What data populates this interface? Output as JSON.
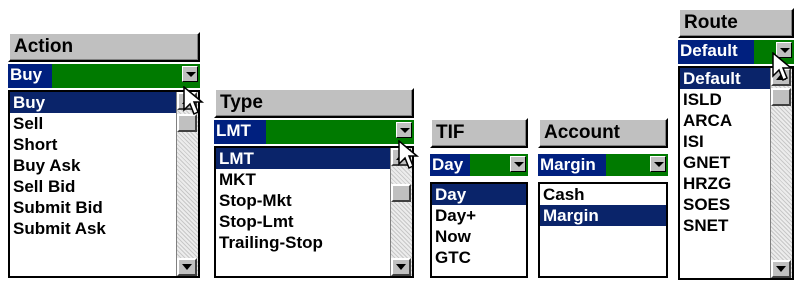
{
  "action": {
    "header": "Action",
    "selected": "Buy",
    "items": [
      "Buy",
      "Sell",
      "Short",
      "Buy Ask",
      "Sell Bid",
      "Submit Bid",
      "Submit Ask"
    ],
    "highlighted_index": 0
  },
  "type": {
    "header": "Type",
    "selected": "LMT",
    "items": [
      "LMT",
      "MKT",
      "Stop-Mkt",
      "Stop-Lmt",
      "Trailing-Stop"
    ],
    "highlighted_index": 0
  },
  "tif": {
    "header": "TIF",
    "selected": "Day",
    "items": [
      "Day",
      "Day+",
      "Now",
      "GTC"
    ],
    "highlighted_index": 0
  },
  "account": {
    "header": "Account",
    "selected": "Margin",
    "items": [
      "Cash",
      "Margin"
    ],
    "highlighted_index": 1
  },
  "route": {
    "header": "Route",
    "selected": "Default",
    "items": [
      "Default",
      "ISLD",
      "ARCA",
      "ISI",
      "GNET",
      "HRZG",
      "SOES",
      "SNET"
    ],
    "highlighted_index": 0
  },
  "colors": {
    "selection_bg": "#0a246a",
    "combo_fill": "#007a00",
    "header_bg": "#c0c0c0"
  }
}
